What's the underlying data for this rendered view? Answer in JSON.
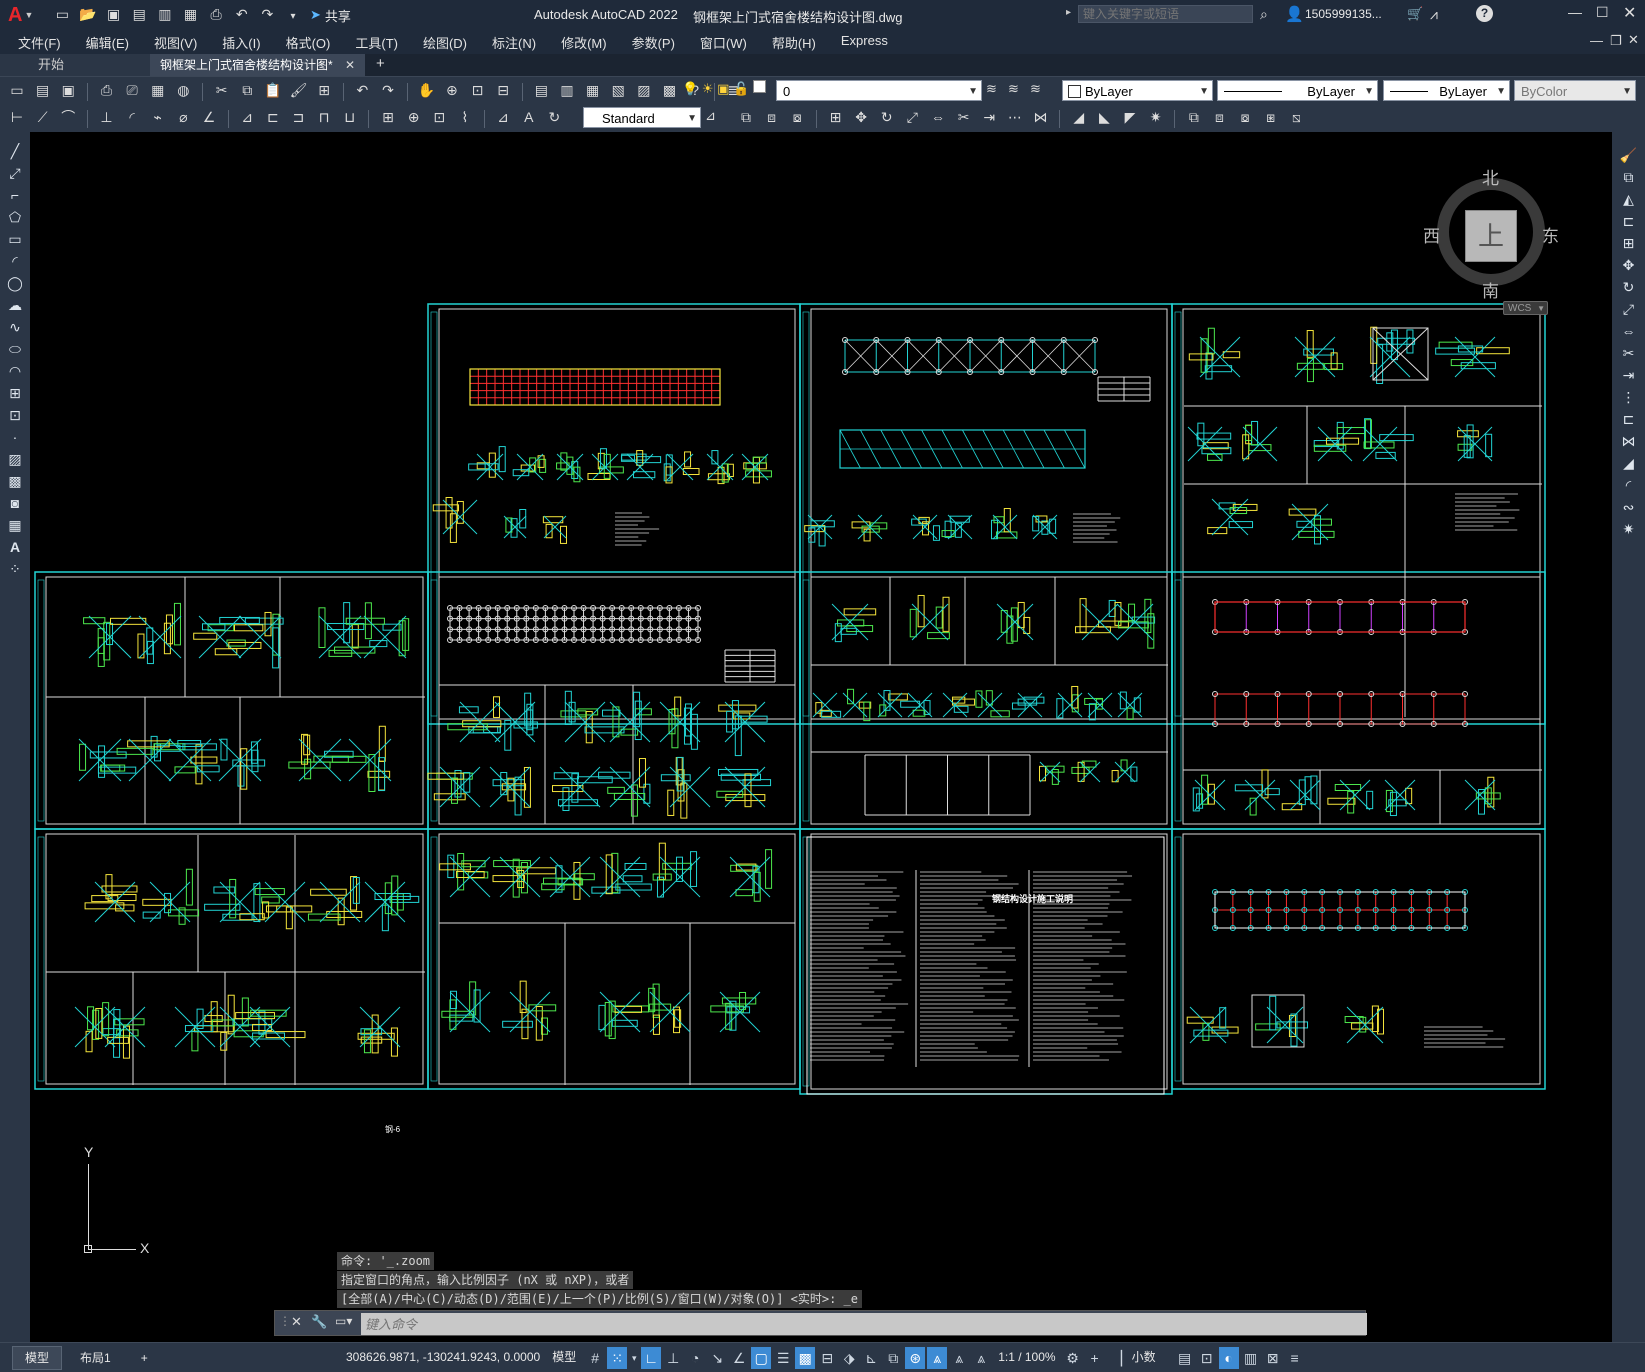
{
  "titlebar": {
    "app_title": "Autodesk AutoCAD 2022",
    "file_name": "钢框架上门式宿舍楼结构设计图.dwg",
    "share_label": "共享",
    "search_placeholder": "键入关键字或短语",
    "user_name": "1505999135..."
  },
  "menu": [
    "文件(F)",
    "编辑(E)",
    "视图(V)",
    "插入(I)",
    "格式(O)",
    "工具(T)",
    "绘图(D)",
    "标注(N)",
    "修改(M)",
    "参数(P)",
    "窗口(W)",
    "帮助(H)",
    "Express"
  ],
  "tabs": {
    "start": "开始",
    "active": "钢框架上门式宿舍楼结构设计图*",
    "add": "+"
  },
  "toolbar": {
    "layer_value": "0",
    "color_value": "ByLayer",
    "linetype_value": "ByLayer",
    "lineweight_value": "ByLayer",
    "plotstyle_value": "ByColor",
    "textstyle_value": "Standard"
  },
  "viewcube": {
    "north": "北",
    "south": "南",
    "east": "东",
    "west": "西",
    "face": "上",
    "wcs": "WCS"
  },
  "ucs": {
    "x": "X",
    "y": "Y"
  },
  "command": {
    "history": [
      "命令: '_.zoom",
      "指定窗口的角点，输入比例因子 (nX 或 nXP)，或者",
      "[全部(A)/中心(C)/动态(D)/范围(E)/上一个(P)/比例(S)/窗口(W)/对象(O)] <实时>: _e"
    ],
    "placeholder": "键入命令"
  },
  "layout_tabs": [
    "模型",
    "布局1",
    "+"
  ],
  "status": {
    "coordinates": "308626.9871, -130241.9243, 0.0000",
    "space": "模型",
    "scale": "1:1 / 100%",
    "units": "小数"
  },
  "drawing": {
    "general_notes_title": "钢结构设计施工说明",
    "sheet_label": "钢-6"
  },
  "colors": {
    "sheet_border": "#22d3d3",
    "background": "#000000",
    "titlebar": "#1f2a3a",
    "toolbar": "#2b3646"
  }
}
